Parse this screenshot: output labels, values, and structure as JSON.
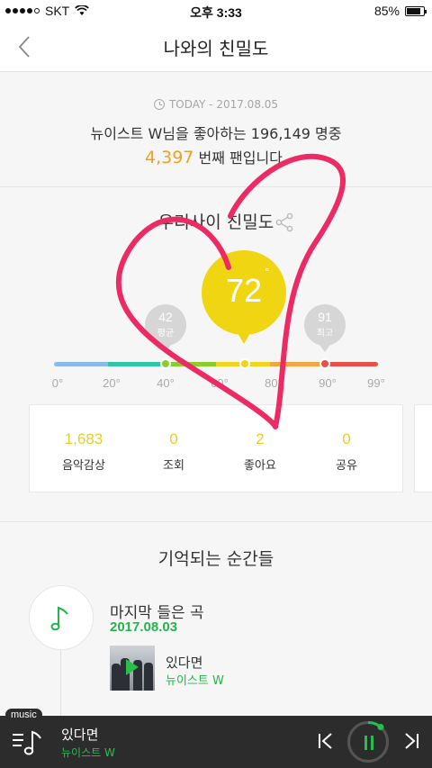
{
  "status_bar": {
    "carrier": "SKT",
    "time": "오후 3:33",
    "battery": "85%",
    "battery_level": 0.85
  },
  "nav": {
    "title": "나와의 친밀도"
  },
  "fan": {
    "today_label": "TODAY - 2017.08.05",
    "line1": "뉴이스트 W님을 좋아하는 196,149 명중",
    "rank": "4,397",
    "rank_suffix": " 번째 팬입니다."
  },
  "affinity": {
    "title": "우리사이 친밀도",
    "my_value": "72",
    "degree_symbol": "°",
    "average": {
      "value": "42",
      "label": "평균"
    },
    "max": {
      "value": "91",
      "label": "최고"
    },
    "ticks": [
      "0°",
      "20°",
      "40°",
      "60°",
      "80°",
      "90°",
      "99°"
    ],
    "colors": {
      "accent_yellow": "#f0d513",
      "average_green": "#88cf2e",
      "max_red": "#e6524b"
    }
  },
  "stats": [
    {
      "value": "1,683",
      "label": "음악감상"
    },
    {
      "value": "0",
      "label": "조회"
    },
    {
      "value": "2",
      "label": "좋아요"
    },
    {
      "value": "0",
      "label": "공유"
    }
  ],
  "memories": {
    "title": "기억되는 순간들",
    "heading": "마지막 들은 곡",
    "date": "2017.08.03",
    "song_title": "있다면",
    "song_artist": "뉴이스트 W"
  },
  "player": {
    "tag": "music",
    "title": "있다면",
    "artist": "뉴이스트 W"
  }
}
